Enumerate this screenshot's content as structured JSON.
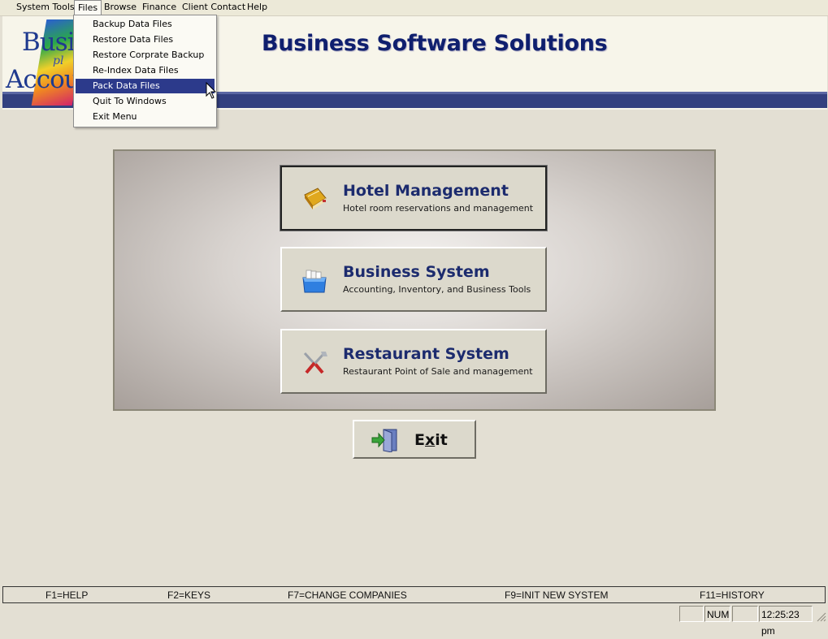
{
  "menubar": {
    "items": [
      "System Tools",
      "Files",
      "Browse",
      "Finance",
      "Client Contact",
      "Help"
    ],
    "open_item": "Files"
  },
  "logo": {
    "line1": "Busi",
    "plus": "pl",
    "line2": "Accou"
  },
  "header": {
    "title": "Business Software Solutions"
  },
  "files_menu": {
    "items": [
      "Backup Data Files",
      "Restore Data Files",
      "Restore Corprate Backup",
      "Re-Index Data Files",
      "Pack Data Files",
      "Quit To Windows",
      "Exit Menu"
    ],
    "highlighted": "Pack Data Files"
  },
  "buttons": {
    "hotel": {
      "title": "Hotel Management",
      "subtitle": "Hotel room reservations and management",
      "icon": "notebook-icon"
    },
    "business": {
      "title": "Business System",
      "subtitle": "Accounting, Inventory, and Business Tools",
      "icon": "blue-box-icon"
    },
    "restaurant": {
      "title": "Restaurant System",
      "subtitle": "Restaurant Point of Sale and management",
      "icon": "fork-knife-icon"
    },
    "exit": {
      "label_pre": "E",
      "label_u": "x",
      "label_post": "it",
      "icon": "exit-door-icon"
    }
  },
  "function_keys": [
    "F1=HELP",
    "F2=KEYS",
    "F7=CHANGE COMPANIES",
    "F9=INIT NEW SYSTEM",
    "F11=HISTORY"
  ],
  "statusbar": {
    "blank": "",
    "num": "NUM",
    "blank2": "",
    "time": "12:25:23 pm"
  },
  "colors": {
    "accent_navy": "#2c3a8b",
    "title_blue": "#0f1f6e",
    "background": "#e3dfd3"
  }
}
